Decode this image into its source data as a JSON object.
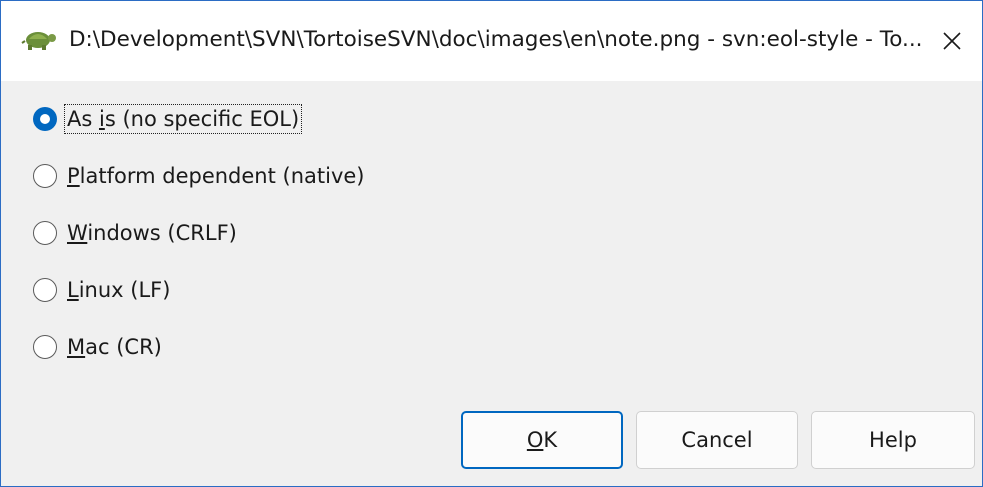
{
  "window": {
    "title": "D:\\Development\\SVN\\TortoiseSVN\\doc\\images\\en\\note.png - svn:eol-style - To...",
    "app_icon": "tortoise-icon",
    "close_icon": "close-icon"
  },
  "options": [
    {
      "prefix": "As ",
      "mnemonic": "i",
      "suffix": "s (no specific EOL)",
      "checked": true
    },
    {
      "prefix": "",
      "mnemonic": "P",
      "suffix": "latform dependent (native)",
      "checked": false
    },
    {
      "prefix": "",
      "mnemonic": "W",
      "suffix": "indows (CRLF)",
      "checked": false
    },
    {
      "prefix": "",
      "mnemonic": "L",
      "suffix": "inux (LF)",
      "checked": false
    },
    {
      "prefix": "",
      "mnemonic": "M",
      "suffix": "ac (CR)",
      "checked": false
    }
  ],
  "buttons": {
    "ok_mnemonic": "O",
    "ok_rest": "K",
    "cancel": "Cancel",
    "help": "Help"
  },
  "colors": {
    "accent": "#0067c0",
    "border": "#2b6cc4"
  }
}
